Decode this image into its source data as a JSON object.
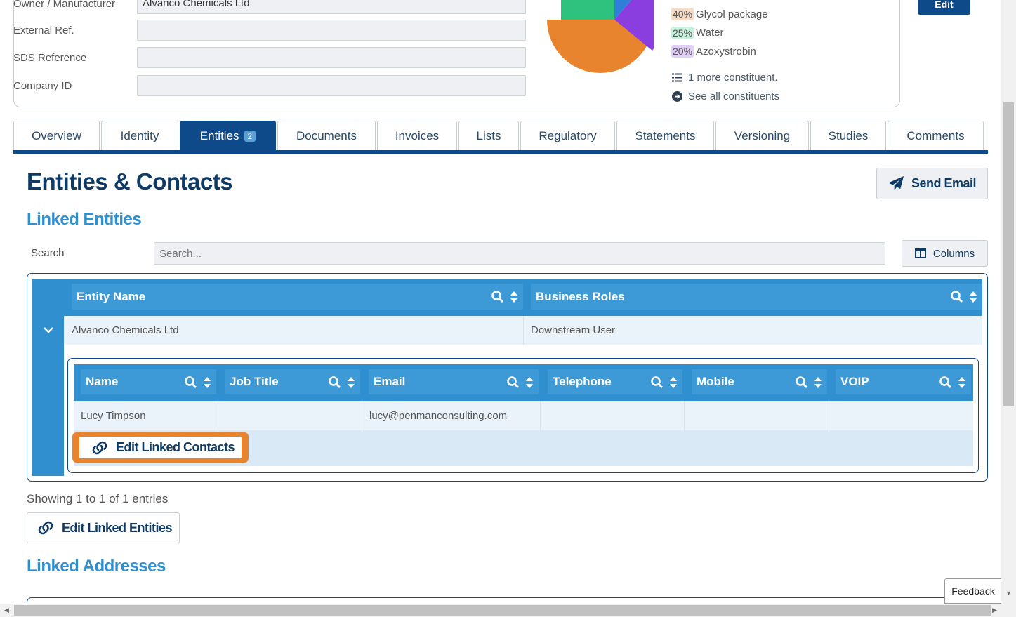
{
  "details": {
    "fields": [
      {
        "label": "Owner / Manufacturer",
        "value": "Alvanco Chemicals Ltd"
      },
      {
        "label": "External Ref.",
        "value": ""
      },
      {
        "label": "SDS Reference",
        "value": ""
      },
      {
        "label": "Company ID",
        "value": ""
      }
    ],
    "edit_label": "Edit"
  },
  "composition": {
    "constituents": [
      {
        "pct": "40%",
        "name": "Glycol package",
        "color": "#e8832e",
        "bg": "#f7dcc5"
      },
      {
        "pct": "25%",
        "name": "Water",
        "color": "#2ec27e",
        "bg": "#c9f0dc"
      },
      {
        "pct": "20%",
        "name": "Azoxystrobin",
        "color": "#8a3ee0",
        "bg": "#e1cff7"
      }
    ],
    "more_label": "1 more constituent.",
    "see_all_label": "See all constituents"
  },
  "tabs": [
    {
      "label": "Overview"
    },
    {
      "label": "Identity"
    },
    {
      "label": "Entities",
      "badge": "2"
    },
    {
      "label": "Documents"
    },
    {
      "label": "Invoices"
    },
    {
      "label": "Lists"
    },
    {
      "label": "Regulatory"
    },
    {
      "label": "Statements"
    },
    {
      "label": "Versioning"
    },
    {
      "label": "Studies"
    },
    {
      "label": "Comments"
    }
  ],
  "page": {
    "title": "Entities & Contacts",
    "send_email_label": "Send Email",
    "linked_entities_heading": "Linked Entities",
    "search_label": "Search",
    "search_placeholder": "Search...",
    "columns_label": "Columns",
    "showing_text": "Showing 1 to 1 of 1 entries",
    "edit_entities_label": "Edit Linked Entities",
    "linked_addresses_heading": "Linked Addresses"
  },
  "entities_table": {
    "headers": [
      "Entity Name",
      "Business Roles"
    ],
    "rows": [
      {
        "entity_name": "Alvanco Chemicals Ltd",
        "business_roles": "Downstream User"
      }
    ]
  },
  "contacts_table": {
    "headers": [
      "Name",
      "Job Title",
      "Email",
      "Telephone",
      "Mobile",
      "VOIP"
    ],
    "rows": [
      {
        "name": "Lucy Timpson",
        "job_title": "",
        "email": "lucy@penmanconsulting.com",
        "telephone": "",
        "mobile": "",
        "voip": ""
      }
    ],
    "edit_contacts_label": "Edit Linked Contacts"
  },
  "feedback_label": "Feedback",
  "colors": {
    "primary": "#0e4a8a",
    "accent": "#2f8fcf",
    "highlight": "#e8832e"
  }
}
